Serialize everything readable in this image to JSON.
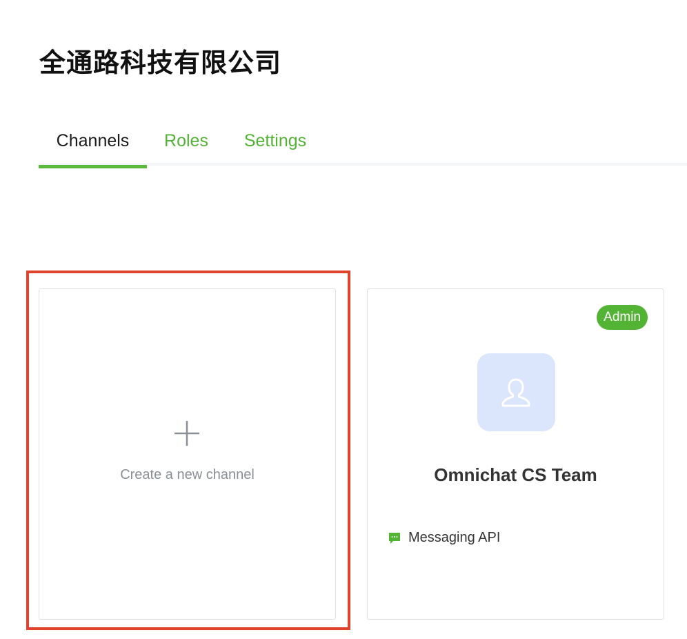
{
  "org": {
    "name": "全通路科技有限公司"
  },
  "tabs": [
    {
      "label": "Channels",
      "active": true
    },
    {
      "label": "Roles",
      "active": false
    },
    {
      "label": "Settings",
      "active": false
    }
  ],
  "create_card": {
    "label": "Create a new channel",
    "icon": "plus-icon"
  },
  "channel_card": {
    "badge": "Admin",
    "name": "Omnichat CS Team",
    "type_label": "Messaging API",
    "avatar_icon": "user-icon",
    "type_icon": "chat-bubble-icon"
  },
  "colors": {
    "accent": "#52b335",
    "highlight": "#e0432b",
    "avatar_bg": "#dbe5fb"
  }
}
